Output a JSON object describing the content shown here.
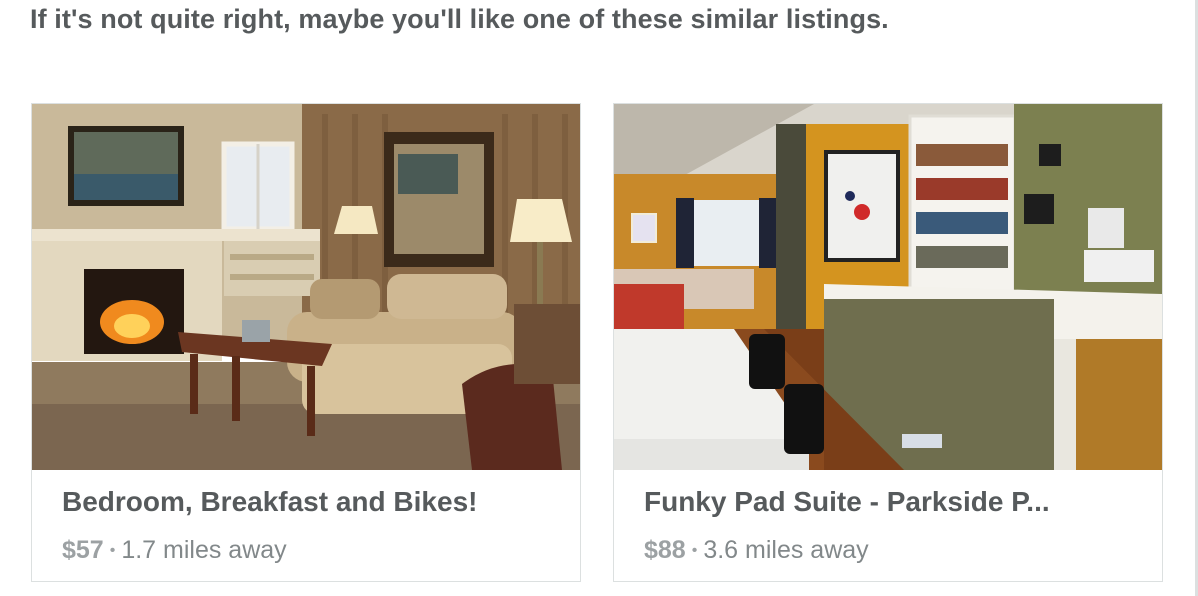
{
  "heading": "If it's not quite right, maybe you'll like one of these similar listings.",
  "listings": [
    {
      "title": "Bedroom, Breakfast and Bikes!",
      "price": "$57",
      "separator": "•",
      "distance": "1.7 miles away"
    },
    {
      "title": "Funky Pad Suite - Parkside P...",
      "price": "$88",
      "separator": "•",
      "distance": "3.6 miles away"
    }
  ],
  "icons": {
    "separator": "bullet-dot"
  }
}
